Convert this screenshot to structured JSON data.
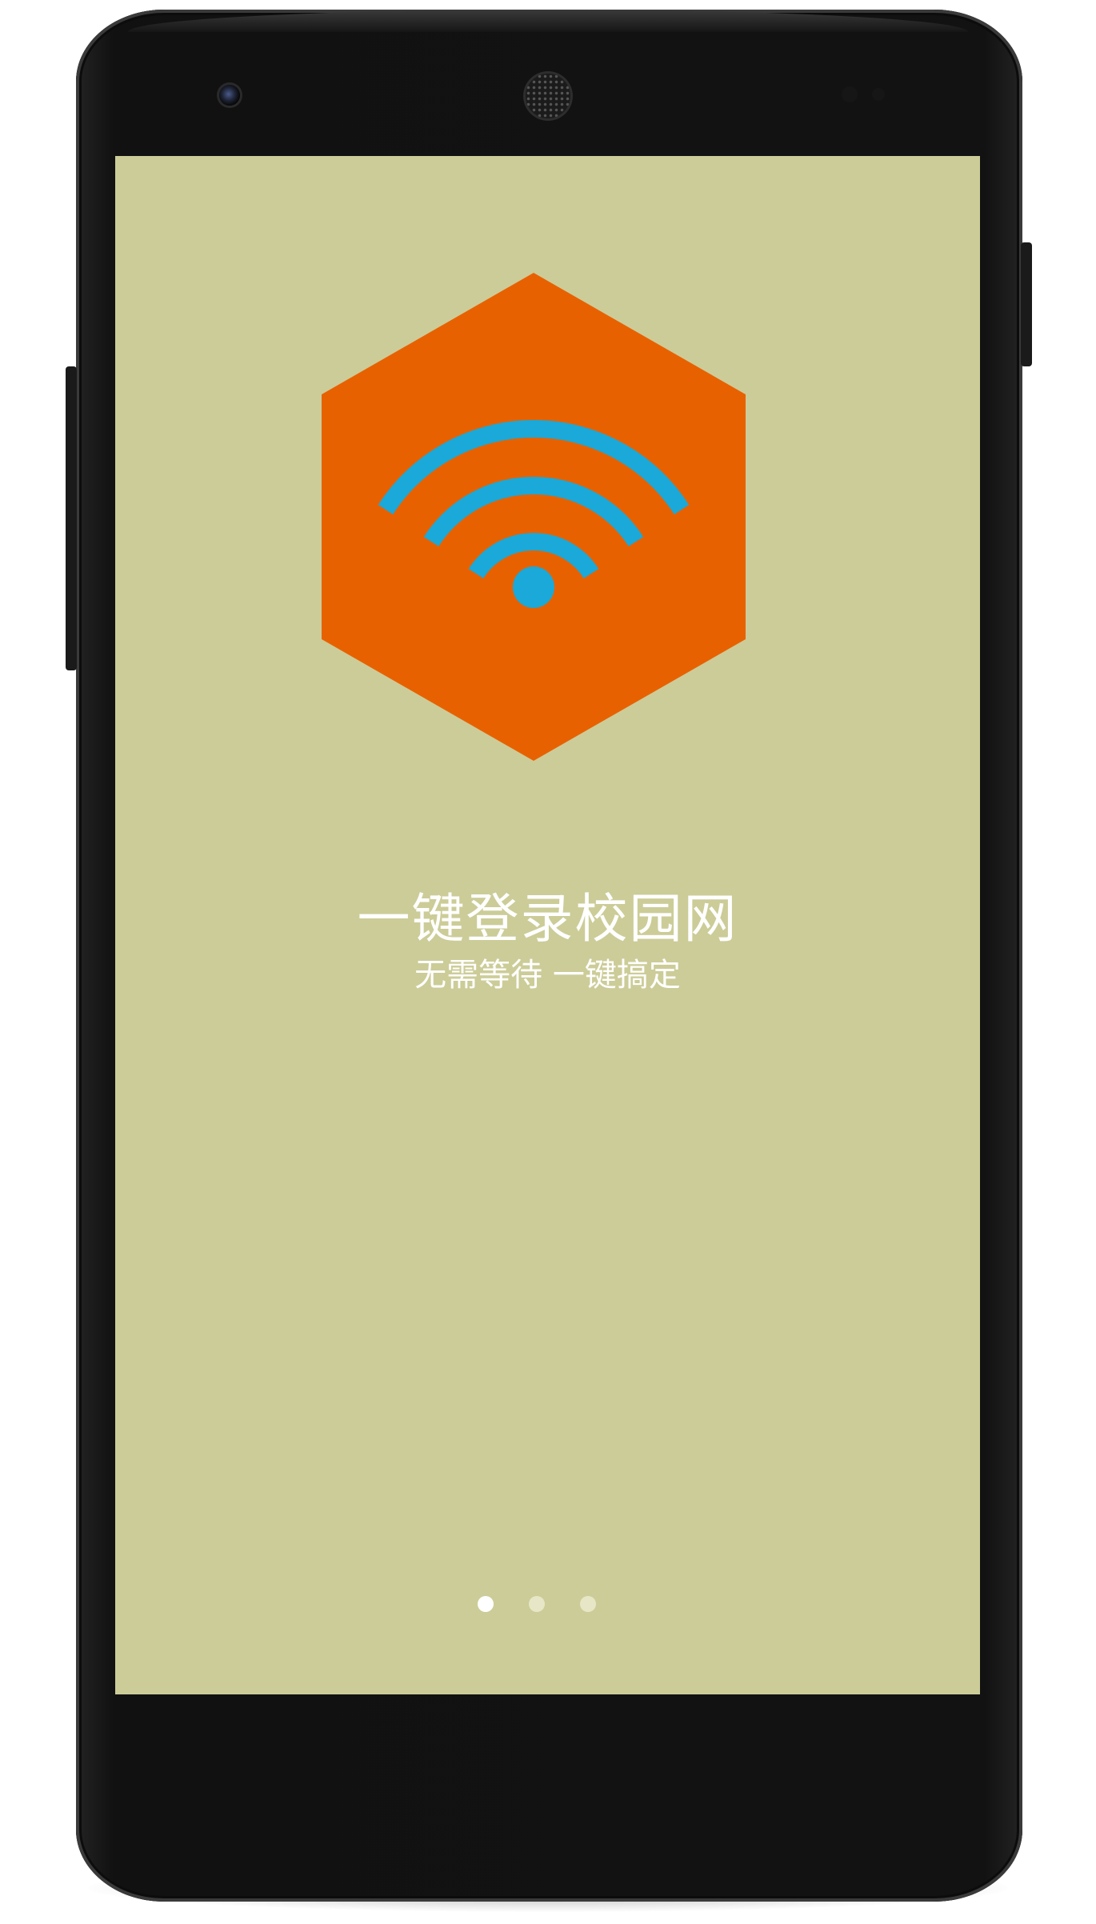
{
  "onboarding": {
    "title": "一键登录校园网",
    "subtitle": "无需等待 一键搞定",
    "logo_icon": "wifi-hexagon-icon",
    "page_indicator": {
      "total": 3,
      "current": 1
    }
  },
  "colors": {
    "screen_background": "#cccc98",
    "logo_hexagon": "#e86100",
    "wifi_signal": "#1aa9d8",
    "text": "#ffffff",
    "dot_active": "#ffffff",
    "dot_inactive": "#e7e7c7",
    "device_frame": "#121212"
  }
}
